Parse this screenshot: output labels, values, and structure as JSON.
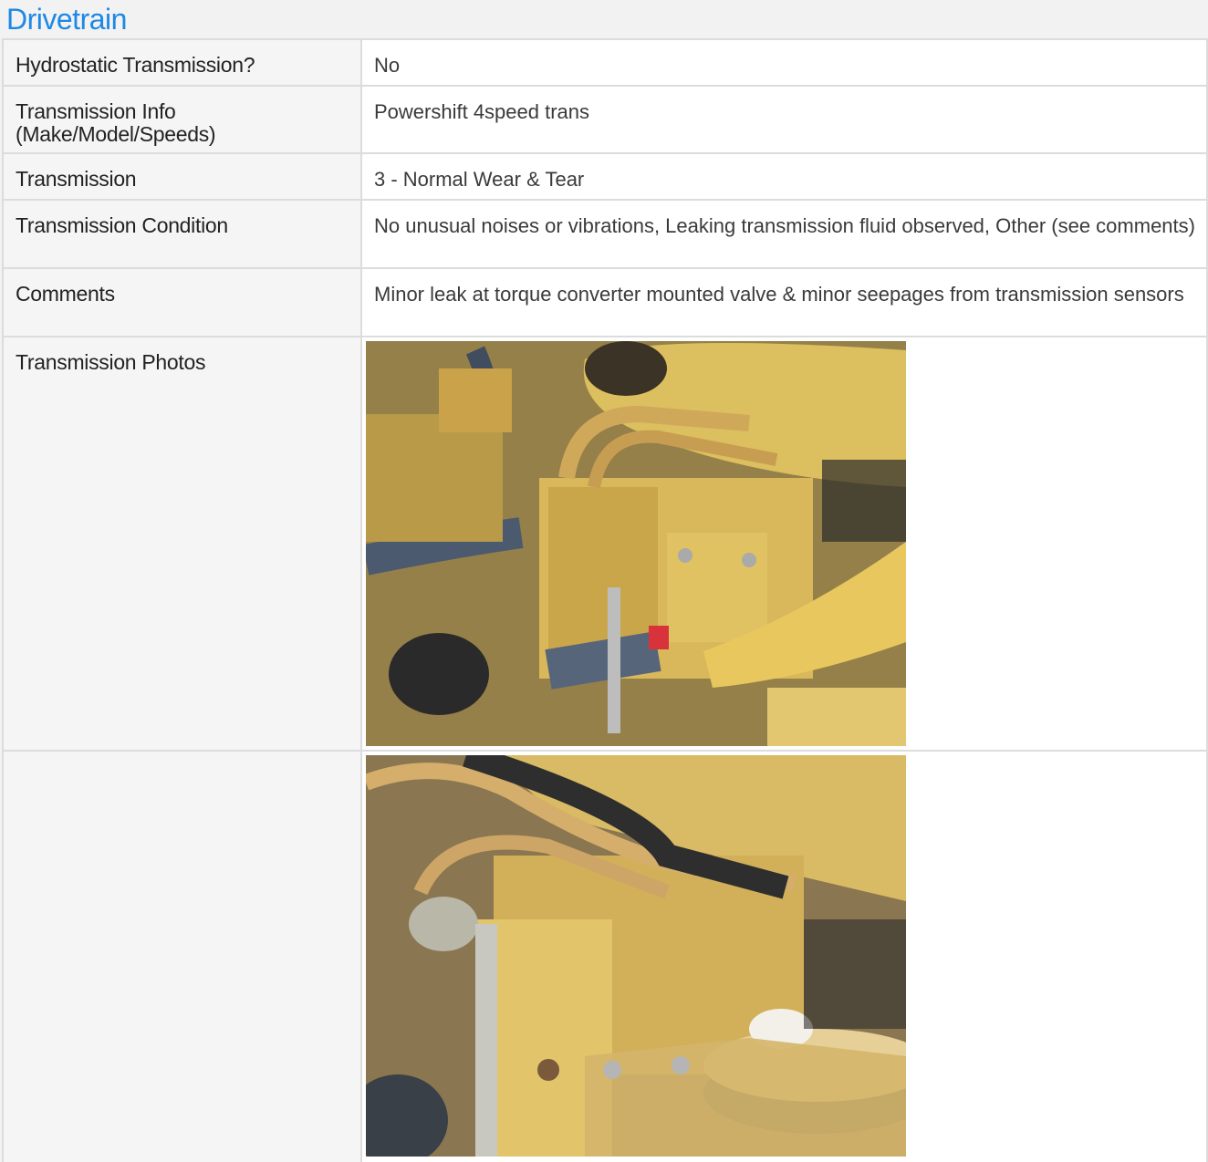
{
  "section": {
    "title": "Drivetrain"
  },
  "rows": [
    {
      "label": "Hydrostatic Transmission?",
      "value": "No"
    },
    {
      "label": "Transmission Info (Make/Model/Speeds)",
      "value": "Powershift 4speed trans"
    },
    {
      "label": "Transmission",
      "value": "3 - Normal Wear & Tear"
    },
    {
      "label": "Transmission Condition",
      "value": "No unusual noises or vibrations, Leaking transmission fluid observed, Other (see comments)"
    },
    {
      "label": "Comments",
      "value": "Minor leak at torque converter mounted valve & minor seepages from transmission sensors"
    },
    {
      "label": "Transmission Photos",
      "value": ""
    }
  ],
  "photos": [
    {
      "name": "transmission-photo-1"
    },
    {
      "name": "transmission-photo-2"
    }
  ],
  "colors": {
    "title": "#1e88e5",
    "label_bg": "#f5f5f5",
    "value_bg": "#ffffff",
    "border": "#dcdcdc",
    "machine_yellow": "#d9b85a"
  }
}
